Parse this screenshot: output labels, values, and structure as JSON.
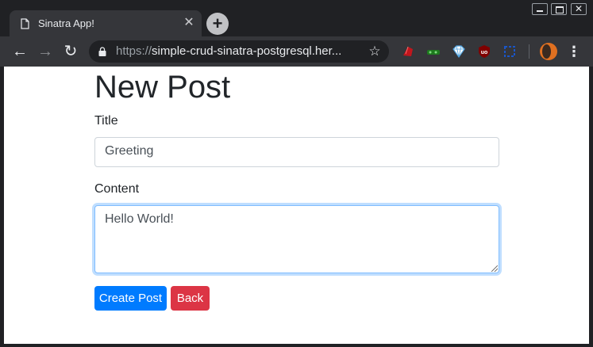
{
  "browser": {
    "tab": {
      "title": "Sinatra App!"
    },
    "url": {
      "scheme": "https://",
      "rest": "simple-crud-sinatra-postgresql.her..."
    }
  },
  "page": {
    "heading": "New Post",
    "title_label": "Title",
    "title_value": "Greeting",
    "content_label": "Content",
    "content_value": "Hello World!",
    "create_button": "Create Post",
    "back_button": "Back"
  },
  "colors": {
    "primary": "#007bff",
    "danger": "#dc3545",
    "chrome_dark": "#202124",
    "chrome_toolbar": "#35363a"
  }
}
